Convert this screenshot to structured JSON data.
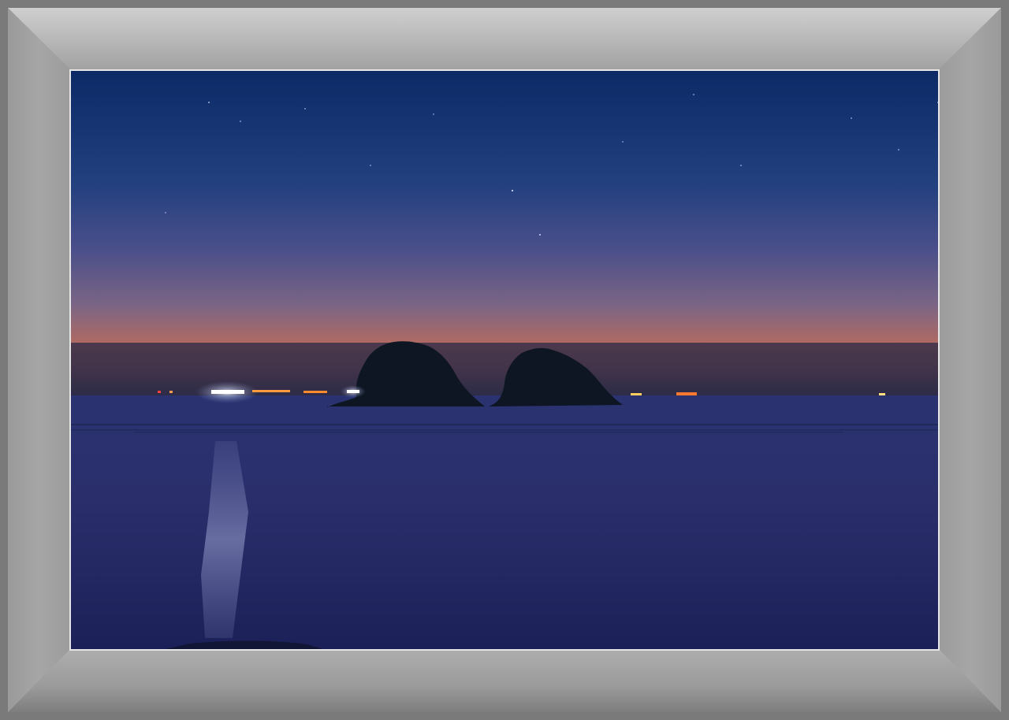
{
  "scene": {
    "subject": "twilight-seascape",
    "colors": {
      "sky_top": "#0a2a66",
      "sky_mid": "#4a4f8a",
      "horizon_glow": "#c0705a",
      "sea": "#2a2f6a",
      "mat": "#a0a0a0"
    }
  }
}
